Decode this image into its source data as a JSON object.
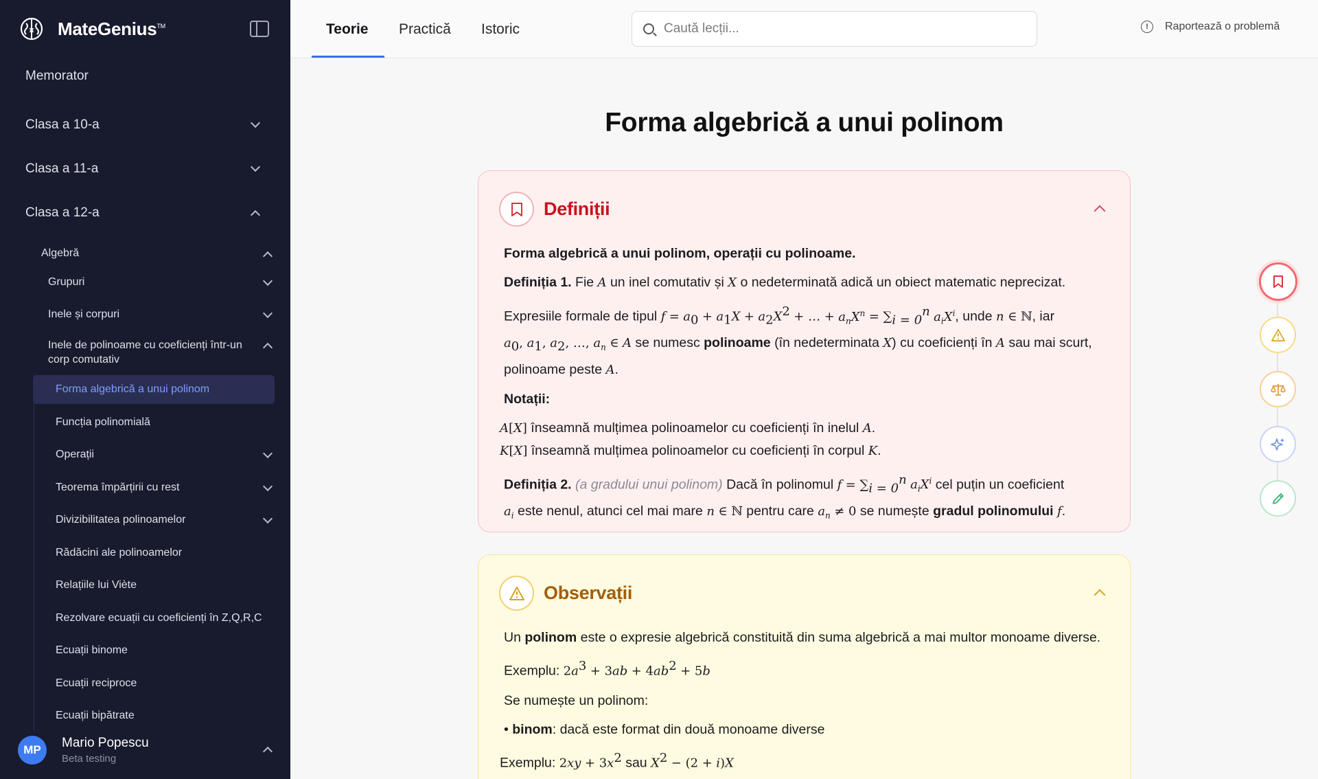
{
  "brand": {
    "name": "MateGenius",
    "tm": "TM"
  },
  "sidebar": {
    "top_items": [
      {
        "label": "Memorator"
      },
      {
        "label": "Clasa a 10-a"
      },
      {
        "label": "Clasa a 11-a"
      },
      {
        "label": "Clasa a 12-a"
      }
    ],
    "algebra": "Algebră",
    "groups": [
      {
        "label": "Grupuri"
      },
      {
        "label": "Inele și corpuri"
      },
      {
        "label": "Inele de polinoame cu coeficienți într-un corp comutativ"
      }
    ],
    "lessons": [
      {
        "label": "Forma algebrică a unui polinom"
      },
      {
        "label": "Funcția polinomială"
      },
      {
        "label": "Operații"
      },
      {
        "label": "Teorema împărțirii cu rest"
      },
      {
        "label": "Divizibilitatea polinoamelor"
      },
      {
        "label": "Rădăcini ale polinoamelor"
      },
      {
        "label": "Relațiile lui Viète"
      },
      {
        "label": "Rezolvare ecuații cu coeficienți în Z,Q,R,C"
      },
      {
        "label": "Ecuații binome"
      },
      {
        "label": "Ecuații reciproce"
      },
      {
        "label": "Ecuații bipătrate"
      }
    ],
    "user": {
      "initials": "MP",
      "name": "Mario Popescu",
      "role": "Beta testing"
    }
  },
  "topbar": {
    "tabs": [
      {
        "label": "Teorie"
      },
      {
        "label": "Practică"
      },
      {
        "label": "Istoric"
      }
    ],
    "search_placeholder": "Caută lecții...",
    "report_label": "Raportează o problemă"
  },
  "page": {
    "title": "Forma algebrică a unui polinom"
  },
  "definitions": {
    "title": "Definiții",
    "heading": "Forma algebrică a unui polinom, operații cu polinoame.",
    "def1_label": "Definiția 1.",
    "def1_t1": " Fie ",
    "def1_t2": " un inel comutativ și ",
    "def1_t3": " o nedeterminată adică un obiect matematic neprecizat.",
    "expr_t1": "Expresiile formale de tipul ",
    "expr_t2": ", unde ",
    "expr_t3": ", iar",
    "expr_t4": " se numesc ",
    "expr_bold": "polinoame",
    "expr_t5": " (în nedeterminata ",
    "expr_t6": ") cu coeficienți în ",
    "expr_t7": " sau mai scurt, polinoame peste ",
    "notations_label": "Notații:",
    "notation1": " înseamnă mulțimea polinoamelor cu coeficienți în inelul ",
    "notation2": " înseamnă mulțimea polinoamelor cu coeficienți în corpul ",
    "def2_label": "Definiția 2.",
    "def2_note": "(a gradului unui polinom)",
    "def2_t1": " Dacă în polinomul ",
    "def2_t2": " cel puțin un coeficient ",
    "def2_t3": " este nenul, atunci cel mai mare ",
    "def2_t4": " pentru care ",
    "def2_t5": " se numește ",
    "def2_bold": "gradul polinomului"
  },
  "observations": {
    "title": "Observații",
    "p1_t1": "Un ",
    "p1_bold": "polinom",
    "p1_t2": " este o expresie algebrică constituită din suma algebrică a mai multor monoame diverse.",
    "example_label": "Exemplu: ",
    "p3": "Se numește un polinom:",
    "bullet_bold": "binom",
    "bullet_text": ": dacă este format din două monoame diverse",
    "example2_label": "Exemplu: ",
    "example2_or": " sau "
  },
  "rail": [
    "bookmark-icon",
    "warning-icon",
    "scale-icon",
    "sparkle-icon",
    "pencil-icon"
  ],
  "colors": {
    "sidebar_bg": "#181a2e",
    "accent": "#3b6fe6",
    "definition": "#c4141b",
    "observation": "#a35d0a"
  }
}
